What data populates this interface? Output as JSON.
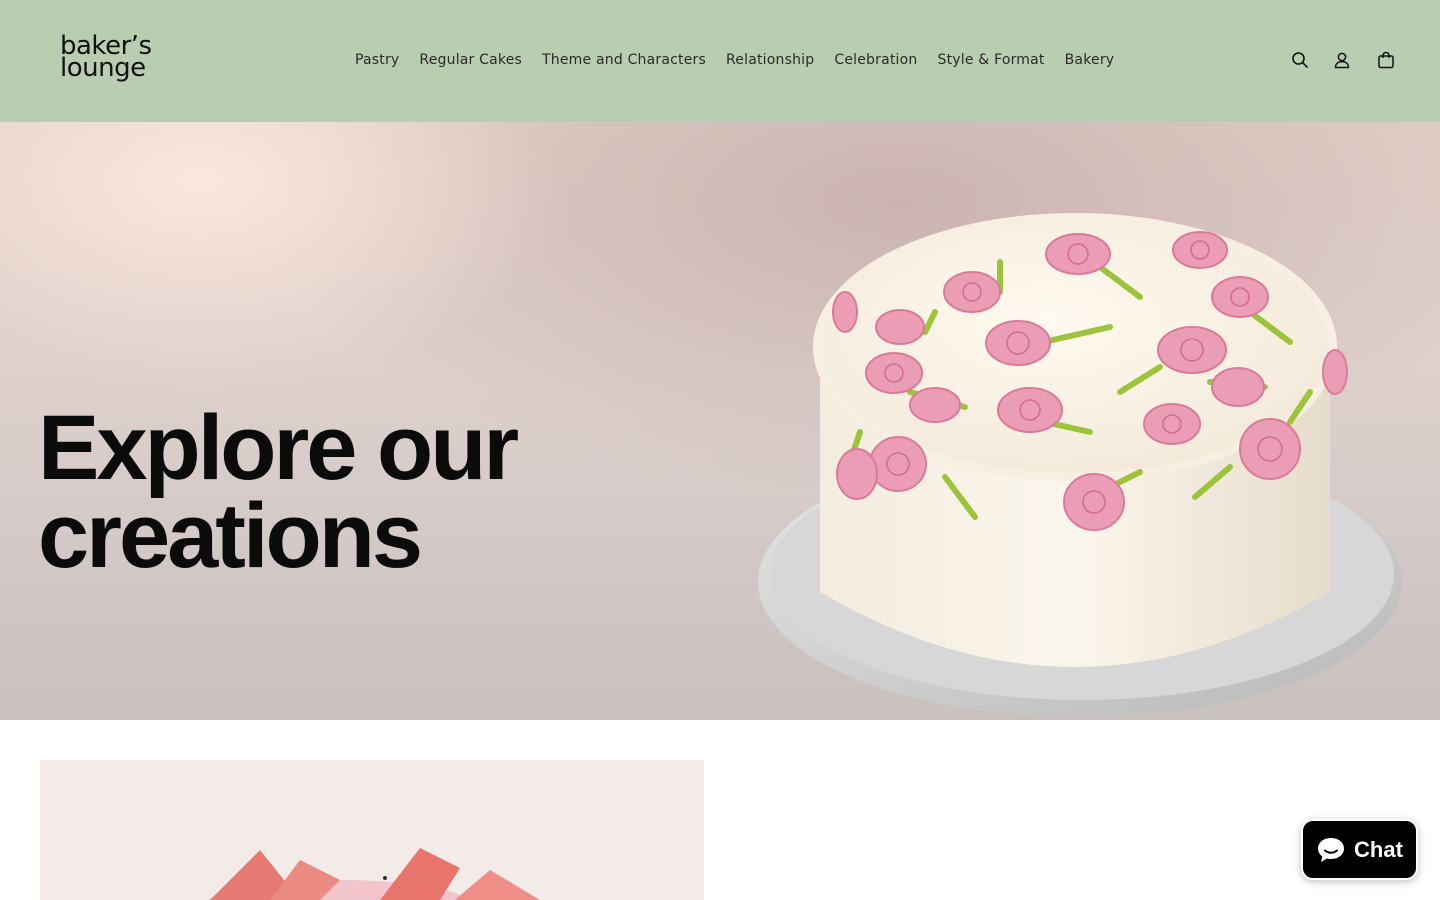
{
  "brand": {
    "logo_line1": "baker’s",
    "logo_line2": "lounge"
  },
  "nav": {
    "items": [
      {
        "label": "Pastry"
      },
      {
        "label": "Regular Cakes"
      },
      {
        "label": "Theme and Characters"
      },
      {
        "label": "Relationship"
      },
      {
        "label": "Celebration"
      },
      {
        "label": "Style & Format"
      },
      {
        "label": "Bakery"
      }
    ]
  },
  "header_icons": [
    "search-icon",
    "account-icon",
    "cart-icon"
  ],
  "hero": {
    "title_line1": "Explore our",
    "title_line2": "creations"
  },
  "chat": {
    "label": "Chat"
  },
  "colors": {
    "header_bg": "#b9cdb1",
    "text": "#121212",
    "chat_bg": "#000000"
  }
}
